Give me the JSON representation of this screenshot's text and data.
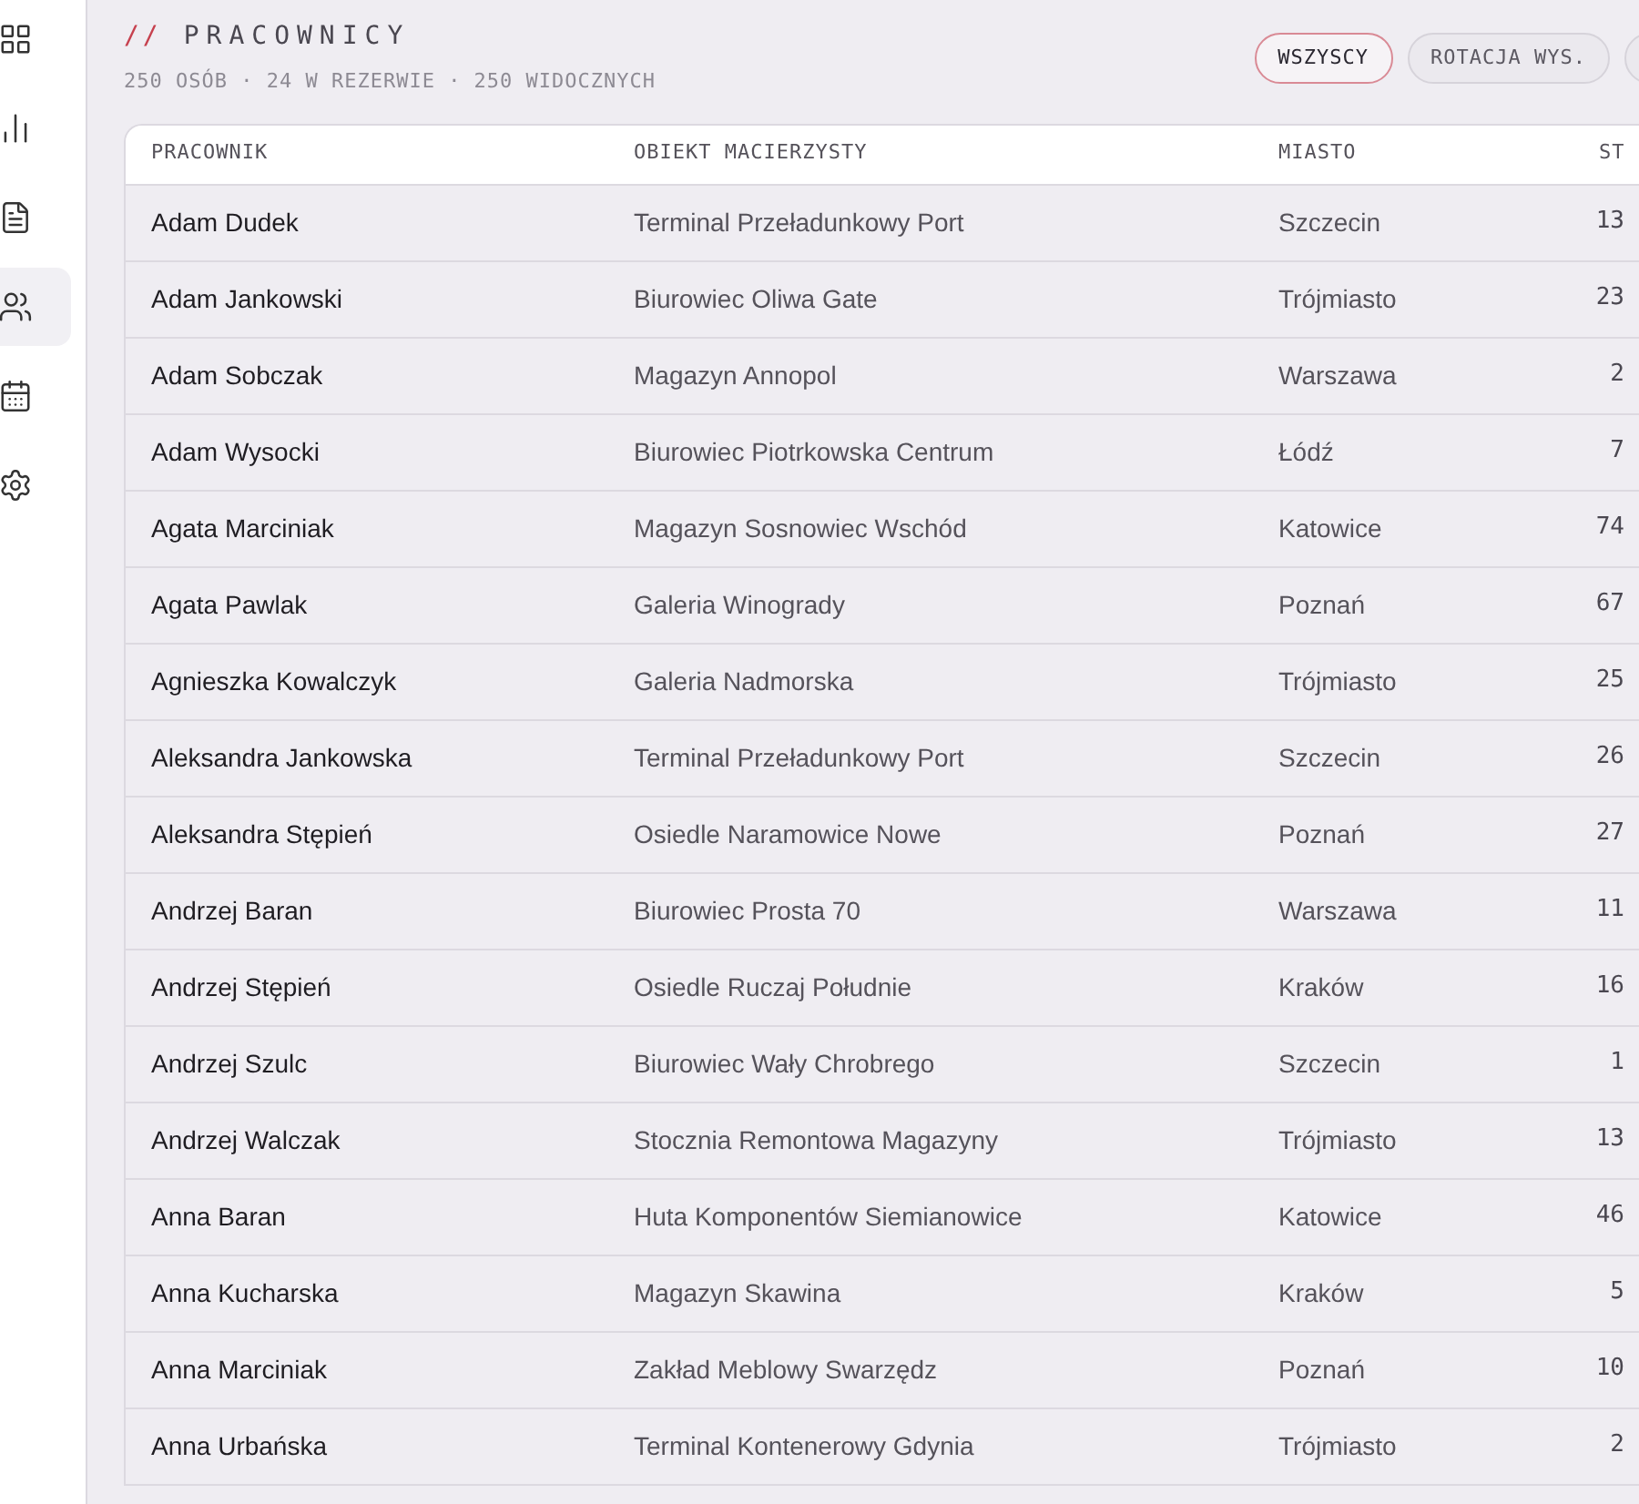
{
  "sidebar": {
    "items": [
      {
        "kind": "grid",
        "selected": false
      },
      {
        "kind": "chart",
        "selected": false
      },
      {
        "kind": "document",
        "selected": false
      },
      {
        "kind": "people",
        "selected": true
      },
      {
        "kind": "calendar",
        "selected": false
      },
      {
        "kind": "settings",
        "selected": false
      }
    ]
  },
  "header": {
    "prefix": "//",
    "title": "PRACOWNICY",
    "subtitle": "250 OSÓB · 24 W REZERWIE · 250 WIDOCZNYCH"
  },
  "filters": [
    {
      "label": "WSZYSCY",
      "selected": true
    },
    {
      "label": "ROTACJA WYS.",
      "selected": false
    },
    {
      "selected": false
    }
  ],
  "table": {
    "columns": [
      "PRACOWNIK",
      "OBIEKT MACIERZYSTY",
      "MIASTO",
      "ST"
    ],
    "rows": [
      [
        "Adam Dudek",
        "Terminal Przeładunkowy Port",
        "Szczecin",
        "13"
      ],
      [
        "Adam Jankowski",
        "Biurowiec Oliwa Gate",
        "Trójmiasto",
        "23"
      ],
      [
        "Adam Sobczak",
        "Magazyn Annopol",
        "Warszawa",
        "2"
      ],
      [
        "Adam Wysocki",
        "Biurowiec Piotrkowska Centrum",
        "Łódź",
        "7"
      ],
      [
        "Agata Marciniak",
        "Magazyn Sosnowiec Wschód",
        "Katowice",
        "74"
      ],
      [
        "Agata Pawlak",
        "Galeria Winogrady",
        "Poznań",
        "67"
      ],
      [
        "Agnieszka Kowalczyk",
        "Galeria Nadmorska",
        "Trójmiasto",
        "25"
      ],
      [
        "Aleksandra Jankowska",
        "Terminal Przeładunkowy Port",
        "Szczecin",
        "26"
      ],
      [
        "Aleksandra Stępień",
        "Osiedle Naramowice Nowe",
        "Poznań",
        "27"
      ],
      [
        "Andrzej Baran",
        "Biurowiec Prosta 70",
        "Warszawa",
        "11"
      ],
      [
        "Andrzej Stępień",
        "Osiedle Ruczaj Południe",
        "Kraków",
        "16"
      ],
      [
        "Andrzej Szulc",
        "Biurowiec Wały Chrobrego",
        "Szczecin",
        "1"
      ],
      [
        "Andrzej Walczak",
        "Stocznia Remontowa Magazyny",
        "Trójmiasto",
        "13"
      ],
      [
        "Anna Baran",
        "Huta Komponentów Siemianowice",
        "Katowice",
        "46"
      ],
      [
        "Anna Kucharska",
        "Magazyn Skawina",
        "Kraków",
        "5"
      ],
      [
        "Anna Marciniak",
        "Zakład Meblowy Swarzędz",
        "Poznań",
        "10"
      ],
      [
        "Anna Urbańska",
        "Terminal Kontenerowy Gdynia",
        "Trójmiasto",
        "2"
      ]
    ]
  }
}
